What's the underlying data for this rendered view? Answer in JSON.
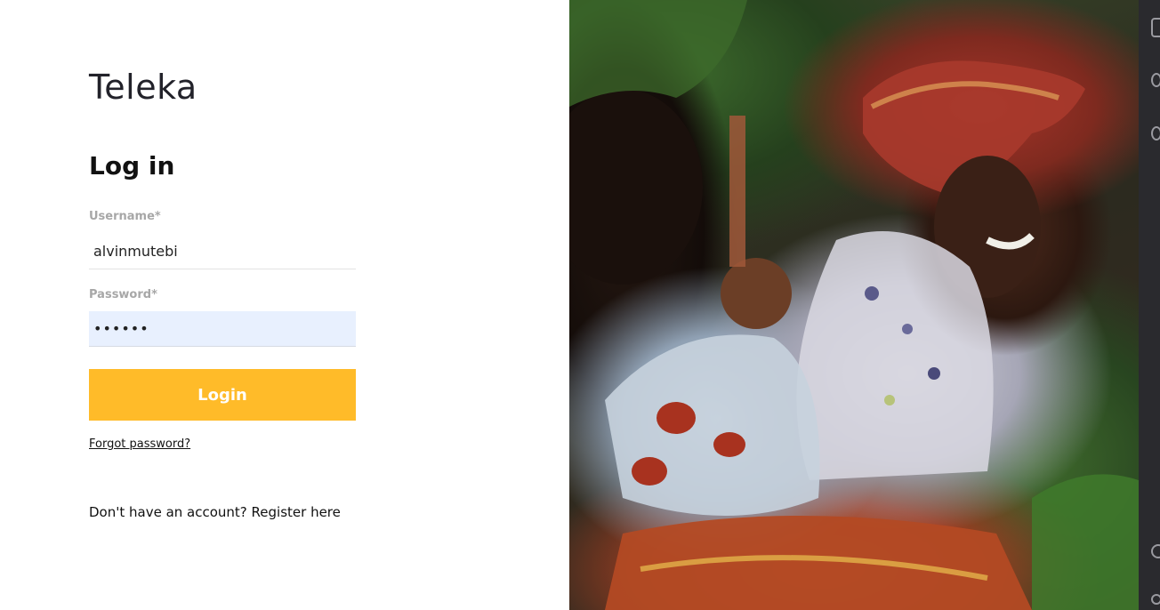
{
  "brand": {
    "name": "Teleka"
  },
  "form": {
    "heading": "Log in",
    "username": {
      "label": "Username*",
      "value": "alvinmutebi",
      "placeholder": ""
    },
    "password": {
      "label": "Password*",
      "value": "••••••",
      "placeholder": ""
    },
    "login_button": "Login",
    "forgot_password": "Forgot password?",
    "register_prompt": "Don't have an account? ",
    "register_link": "Register here"
  },
  "colors": {
    "accent": "#ffbb29",
    "label_gray": "#a7a7a7",
    "autofill_bg": "#e8f0fe"
  },
  "hero_image": {
    "description_icon": "photo-image"
  }
}
